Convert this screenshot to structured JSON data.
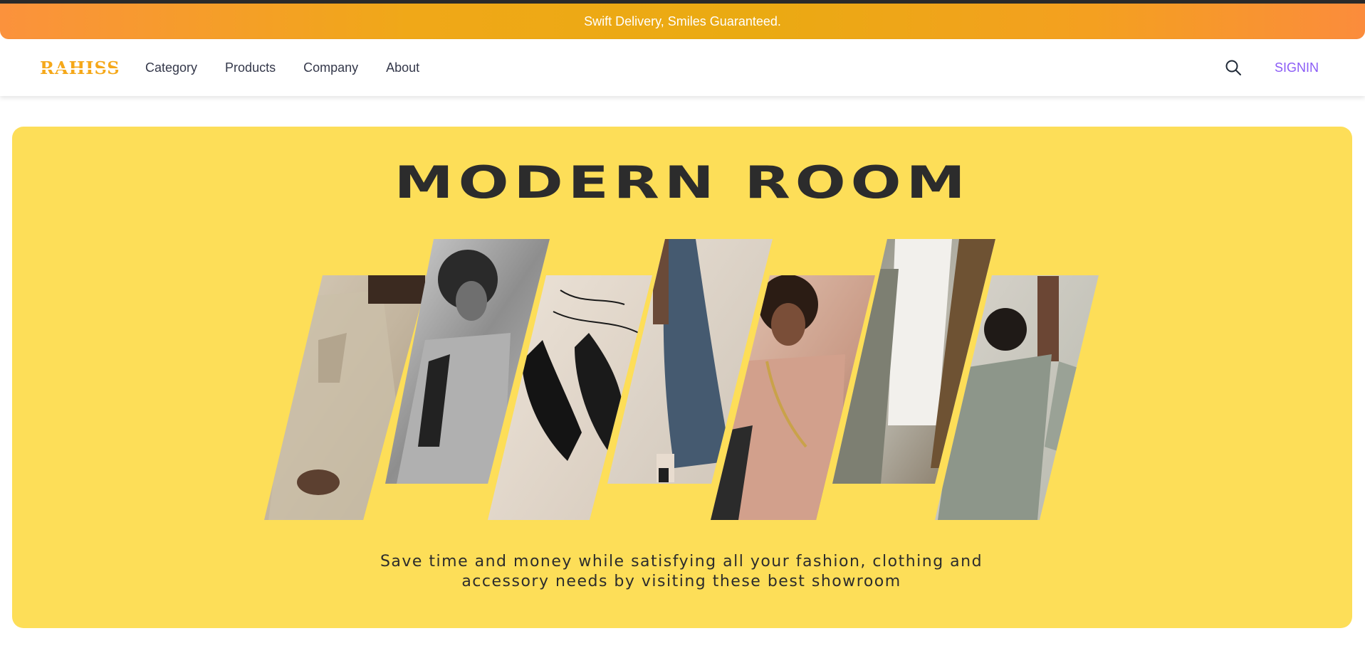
{
  "announcement": {
    "text": "Swift Delivery, Smiles Guaranteed."
  },
  "header": {
    "logo": "RAHISS",
    "nav": [
      {
        "label": "Category"
      },
      {
        "label": "Products"
      },
      {
        "label": "Company"
      },
      {
        "label": "About"
      }
    ],
    "search_icon": "search-icon",
    "signin_label": "SIGNIN"
  },
  "hero": {
    "title": "MODERN ROOM",
    "subtitle_line1": "Save time and money while satisfying all your fashion, clothing and",
    "subtitle_line2": "accessory needs by visiting these best showroom",
    "images": [
      {
        "label": "beige-shirt-model-photo"
      },
      {
        "label": "bw-portrait-model-photo"
      },
      {
        "label": "black-heels-photo"
      },
      {
        "label": "blue-dress-photo"
      },
      {
        "label": "pink-blazer-model-photo"
      },
      {
        "label": "hanging-clothes-photo"
      },
      {
        "label": "grey-shirt-model-photo"
      }
    ]
  },
  "colors": {
    "announcement_start": "#fb923c",
    "announcement_mid": "#eaaa12",
    "logo": "#f5a81a",
    "signin": "#8b5cf6",
    "hero_bg": "#fdde58",
    "hero_text": "#2c2c2c"
  }
}
